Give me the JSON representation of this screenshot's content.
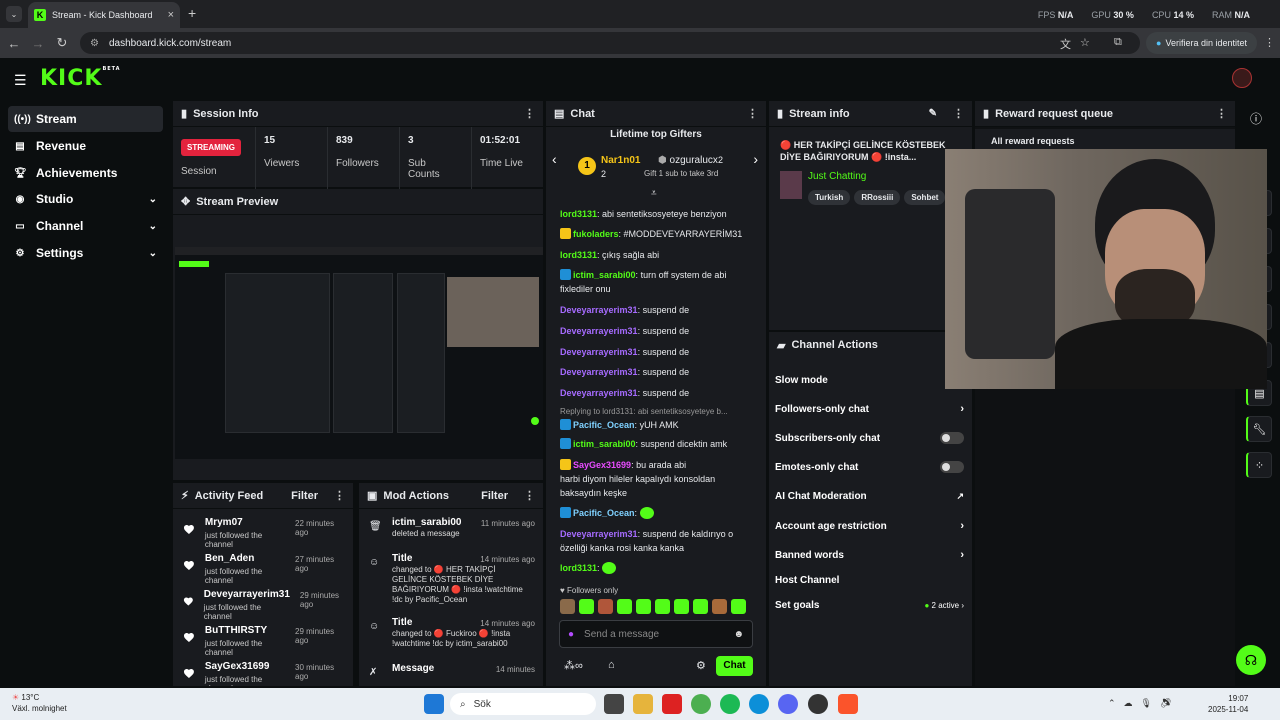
{
  "browser": {
    "tab_title": "Stream - Kick Dashboard",
    "url": "dashboard.kick.com/stream",
    "verify_label": "Verifiera din identitet",
    "perf": [
      {
        "label": "FPS",
        "value": "N/A"
      },
      {
        "label": "GPU",
        "value": "30 %"
      },
      {
        "label": "CPU",
        "value": "14 %"
      },
      {
        "label": "RAM",
        "value": "N/A"
      }
    ]
  },
  "logo": {
    "text": "KICK",
    "sup": "BETA"
  },
  "sidebar": {
    "items": [
      {
        "label": "Stream",
        "icon": "broadcast-icon"
      },
      {
        "label": "Revenue",
        "icon": "revenue-icon"
      },
      {
        "label": "Achievements",
        "icon": "trophy-icon"
      },
      {
        "label": "Studio",
        "icon": "studio-icon"
      },
      {
        "label": "Channel",
        "icon": "channel-icon"
      },
      {
        "label": "Settings",
        "icon": "gear-icon"
      }
    ]
  },
  "session": {
    "title": "Session Info",
    "status_badge": "STREAMING",
    "status_label": "Session",
    "viewers": "15",
    "viewers_label": "Viewers",
    "followers": "839",
    "followers_label": "Followers",
    "subs": "3",
    "subs_label": "Sub Counts",
    "time": "01:52:01",
    "time_label": "Time Live"
  },
  "preview": {
    "title": "Stream Preview"
  },
  "activity": {
    "title": "Activity Feed",
    "filter": "Filter",
    "items": [
      {
        "name": "Mrym07",
        "action": "just followed the channel",
        "time": "22 minutes ago"
      },
      {
        "name": "Ben_Aden",
        "action": "just followed the channel",
        "time": "27 minutes ago"
      },
      {
        "name": "Deveyarrayerim31",
        "action": "just followed the channel",
        "time": "29 minutes ago"
      },
      {
        "name": "BuTTHIRSTY",
        "action": "just followed the channel",
        "time": "29 minutes ago"
      },
      {
        "name": "SayGex31699",
        "action": "just followed the channel",
        "time": "30 minutes ago"
      }
    ]
  },
  "mod": {
    "title": "Mod Actions",
    "filter": "Filter",
    "items": [
      {
        "title": "ictim_sarabi00",
        "time": "11 minutes ago",
        "line1": "deleted a message",
        "line2": "",
        "line3": "",
        "line4": ""
      },
      {
        "title": "Title",
        "time": "14 minutes ago",
        "line1": "changed to 🔴 HER TAKİPÇİ",
        "line2": "GELİNCE KÖSTEBEK DİYE",
        "line3": "BAĞIRIYORUM 🔴 !insta !watchtime",
        "line4": "!dc by Pacific_Ocean"
      },
      {
        "title": "Title",
        "time": "14 minutes ago",
        "line1": "changed to 🔴 Fuckiroo 🔴 !insta",
        "line2": "!watchtime !dc by ictim_sarabi00",
        "line3": "",
        "line4": ""
      },
      {
        "title": "Message",
        "time": "14 minutes",
        "line1": "",
        "line2": "",
        "line3": "",
        "line4": ""
      }
    ]
  },
  "chat": {
    "title": "Chat",
    "gifters_title": "Lifetime top Gifters",
    "gifter1_name": "Nar1n01",
    "gifter1_count": "2",
    "gifter2_name": "ozguralucx",
    "gifter2_count": "2",
    "gifter3_count": "2",
    "gift_cta": "Gift 1 sub to take 3rd",
    "messages": [
      {
        "user": "lord3131",
        "text": "abi sentetiksosyeteye benziyon"
      },
      {
        "user": "fukoladers",
        "text": "#MODDEVEYARRAYERİM31"
      },
      {
        "user": "lord3131",
        "text": "çıkış sağla abi"
      },
      {
        "user": "ictim_sarabi00",
        "text": "turn off system de abi"
      },
      {
        "user": "",
        "text": "fixlediler onu"
      },
      {
        "user": "Deveyarrayerim31",
        "text": "suspend de"
      },
      {
        "user": "Deveyarrayerim31",
        "text": "suspend de"
      },
      {
        "user": "Deveyarrayerim31",
        "text": "suspend de"
      },
      {
        "user": "Deveyarrayerim31",
        "text": "suspend de"
      },
      {
        "user": "Deveyarrayerim31",
        "text": "suspend de"
      },
      {
        "user": "",
        "text": "Replying to lord3131: abi sentetiksosyeteye b..."
      },
      {
        "user": "Pacific_Ocean",
        "text": "yUH AMK"
      },
      {
        "user": "ictim_sarabi00",
        "text": "suspend dicektin amk"
      },
      {
        "user": "SayGex31699",
        "text": "bu arada abi"
      },
      {
        "user": "",
        "text": "harbi diyom hileler kapalıydı konsoldan"
      },
      {
        "user": "",
        "text": "baksaydın keşke"
      },
      {
        "user": "Pacific_Ocean",
        "text": ""
      },
      {
        "user": "Deveyarrayerim31",
        "text": "suspend de kaldırıyo o"
      },
      {
        "user": "",
        "text": "özelliği kanka rosi kanka kanka"
      },
      {
        "user": "lord3131",
        "text": ""
      }
    ],
    "followers_only": "Followers only",
    "input_placeholder": "Send a message",
    "send_label": "Chat"
  },
  "stream_info": {
    "title": "Stream info",
    "stream_title_line1": "🔴 HER TAKİPÇİ GELİNCE KÖSTEBEK",
    "stream_title_line2": "DİYE BAĞIRIYORUM 🔴 !insta...",
    "category": "Just Chatting",
    "tags": [
      "Turkish",
      "RRossiii",
      "Sohbet"
    ]
  },
  "channel_actions": {
    "title": "Channel Actions",
    "items": [
      {
        "label": "Slow mode",
        "right": ""
      },
      {
        "label": "Followers-only chat",
        "right": "›"
      },
      {
        "label": "Subscribers-only chat",
        "right": ""
      },
      {
        "label": "Emotes-only chat",
        "right": ""
      },
      {
        "label": "AI Chat Moderation",
        "right": "↗"
      },
      {
        "label": "Account age restriction",
        "right": "›"
      },
      {
        "label": "Banned words",
        "right": "›"
      },
      {
        "label": "Host Channel",
        "right": ""
      },
      {
        "label": "Set goals",
        "right": "2 active"
      }
    ]
  },
  "reward": {
    "title": "Reward request queue",
    "all": "All reward requests"
  },
  "taskbar": {
    "temp": "13°C",
    "weather": "Växl. molnighet",
    "search": "Sök",
    "time": "19:07",
    "date": "2025-11-04"
  },
  "colors": {
    "accent": "#53fc18",
    "streaming": "#e3233d",
    "panel": "#191b1f",
    "bg": "#0b0e0f"
  }
}
